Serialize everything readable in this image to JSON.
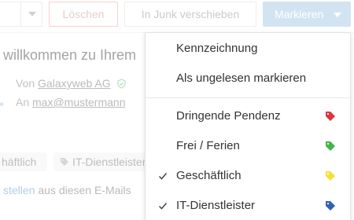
{
  "toolbar": {
    "delete_label": "Löschen",
    "junk_label": "In Junk verschieben",
    "mark_label": "Markieren"
  },
  "email": {
    "subject": "willkommen zu Ihrem",
    "from_prefix": "Von",
    "from_name": "Galaxyweb AG",
    "to_prefix": "An",
    "to_address": "max@mustermann",
    "tags": [
      "häftlich",
      "IT-Dienstleister"
    ],
    "footer_link": "stellen",
    "footer_text": " aus diesen E-Mails"
  },
  "menu": {
    "items": [
      {
        "label": "Kennzeichnung",
        "checked": false
      },
      {
        "label": "Als ungelesen markieren",
        "checked": false
      }
    ],
    "tags": [
      {
        "label": "Dringende Pendenz",
        "checked": false,
        "color": "#e0343f"
      },
      {
        "label": "Frei / Ferien",
        "checked": false,
        "color": "#43b54a"
      },
      {
        "label": "Geschäftlich",
        "checked": true,
        "color": "#f2e13a"
      },
      {
        "label": "IT-Dienstleister",
        "checked": true,
        "color": "#2f62b5"
      }
    ]
  },
  "colors": {
    "accent": "#9cc4e3",
    "delete_border": "#ea9a95",
    "link": "#4a90c8"
  }
}
